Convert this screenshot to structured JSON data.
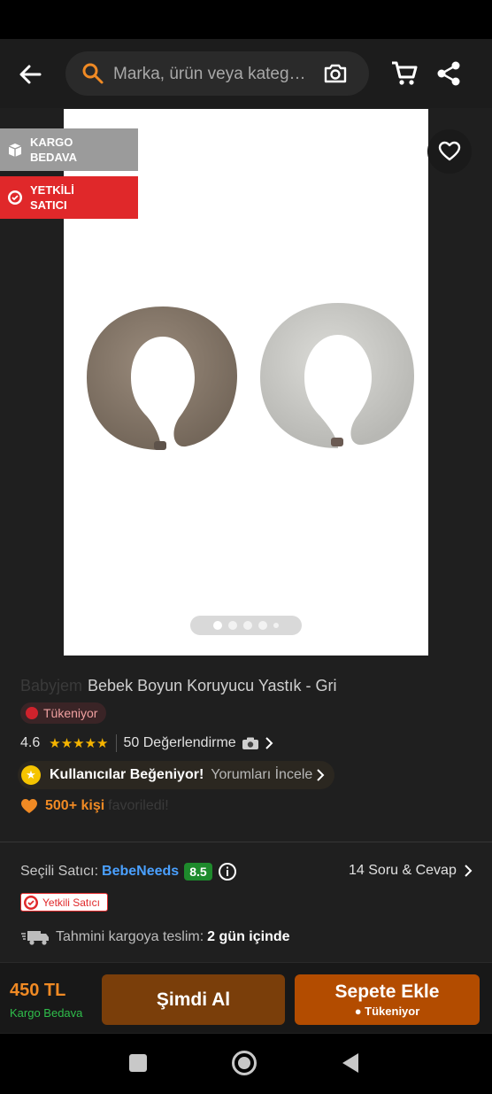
{
  "header": {
    "search_placeholder": "Marka, ürün veya kateg…"
  },
  "badges": {
    "kargo": "KARGO\nBEDAVA",
    "kargo_line1": "KARGO",
    "kargo_line2": "BEDAVA",
    "yetkili_line1": "YETKİLİ",
    "yetkili_line2": "SATICI"
  },
  "product": {
    "brand": "Babyjem",
    "title": "Bebek Boyun Koruyucu Yastık - Gri",
    "stock_status": "Tükeniyor",
    "rating": "4.6",
    "stars": "★★★★★",
    "review_count": "50 Değerlendirme",
    "liked_label": "Kullanıcılar Beğeniyor!",
    "reviews_link": "Yorumları İncele",
    "fav_count": "500+ kişi",
    "fav_suffix": "favoriledi!",
    "image_page": 1,
    "image_total": 5
  },
  "seller": {
    "label": "Seçili Satıcı:",
    "name": "BebeNeeds",
    "score": "8.5",
    "qa_link": "14 Soru & Cevap",
    "auth_badge": "Yetkili Satıcı",
    "ship_label": "Tahmini kargoya teslim:",
    "ship_days": "2 gün içinde"
  },
  "bottom": {
    "price": "450 TL",
    "shipping": "Kargo Bedava",
    "buy_now": "Şimdi Al",
    "add_to_cart": "Sepete Ekle",
    "add_to_cart_sub": "● Tükeniyor"
  },
  "colors": {
    "accent": "#f08a24",
    "buy_now_bg": "#7a3e0a",
    "add_cart_bg": "#b34c00",
    "authorized_red": "#e0282a",
    "free_shipping_green": "#2fbe4b",
    "seller_link_blue": "#4aa0ff"
  },
  "icons": [
    "back-arrow-icon",
    "search-icon",
    "camera-icon",
    "cart-icon",
    "share-icon",
    "heart-icon",
    "box-icon",
    "verified-icon",
    "star-icon",
    "heart-orange-icon",
    "info-icon",
    "truck-icon",
    "chevron-right-icon",
    "nav-recents-icon",
    "nav-home-icon",
    "nav-back-icon"
  ]
}
